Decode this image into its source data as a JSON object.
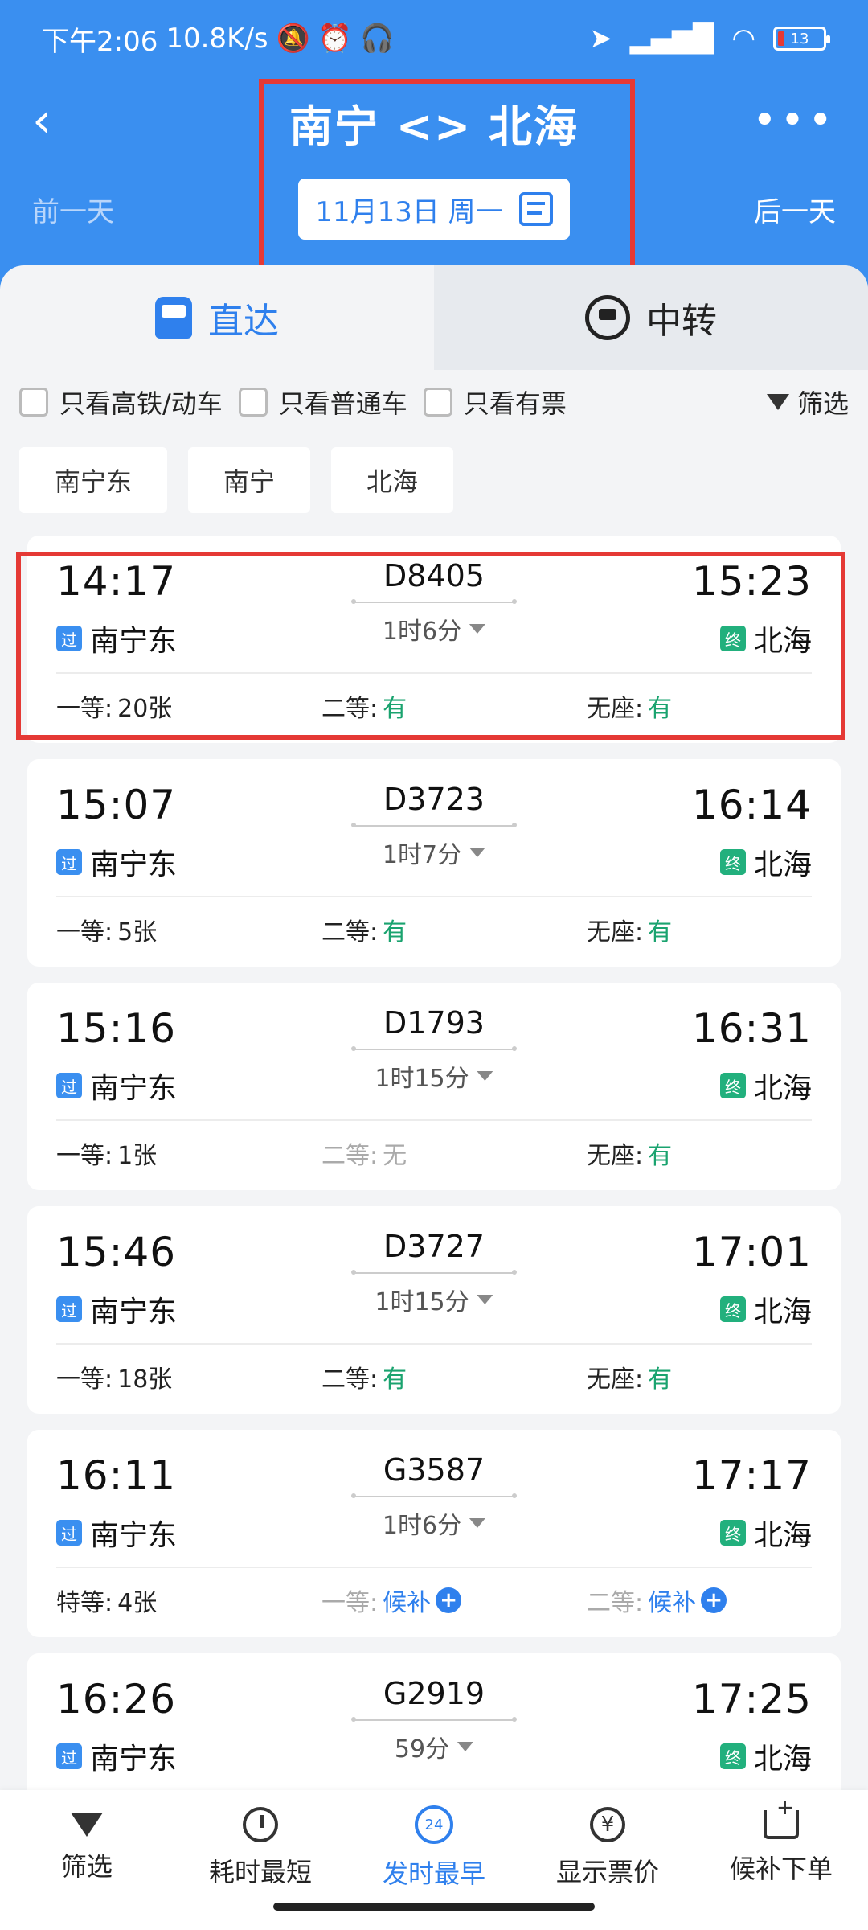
{
  "status_bar": {
    "time": "下午2:06",
    "net_speed": "10.8K/s",
    "battery": "13"
  },
  "header": {
    "title": "南宁 <> 北海",
    "prev_day": "前一天",
    "next_day": "后一天",
    "date": "11月13日 周一"
  },
  "mode_tabs": [
    {
      "label": "直达"
    },
    {
      "label": "中转"
    }
  ],
  "filters": {
    "only_high_speed": "只看高铁/动车",
    "only_normal": "只看普通车",
    "only_available": "只看有票",
    "filter_label": "筛选"
  },
  "stations": [
    "南宁东",
    "南宁",
    "北海"
  ],
  "trains": [
    {
      "dep_time": "14:17",
      "arr_time": "15:23",
      "train_no": "D8405",
      "duration": "1时6分",
      "dep_tag": "过",
      "dep_station": "南宁东",
      "arr_tag": "终",
      "arr_station": "北海",
      "seat1_label": "一等:",
      "seat1_value": "20张",
      "seat2_label": "二等:",
      "seat2_value": "有",
      "seat3_label": "无座:",
      "seat3_value": "有"
    },
    {
      "dep_time": "15:07",
      "arr_time": "16:14",
      "train_no": "D3723",
      "duration": "1时7分",
      "dep_tag": "过",
      "dep_station": "南宁东",
      "arr_tag": "终",
      "arr_station": "北海",
      "seat1_label": "一等:",
      "seat1_value": "5张",
      "seat2_label": "二等:",
      "seat2_value": "有",
      "seat3_label": "无座:",
      "seat3_value": "有"
    },
    {
      "dep_time": "15:16",
      "arr_time": "16:31",
      "train_no": "D1793",
      "duration": "1时15分",
      "dep_tag": "过",
      "dep_station": "南宁东",
      "arr_tag": "终",
      "arr_station": "北海",
      "seat1_label": "一等:",
      "seat1_value": "1张",
      "seat2_label": "二等:",
      "seat2_value": "无",
      "seat3_label": "无座:",
      "seat3_value": "有"
    },
    {
      "dep_time": "15:46",
      "arr_time": "17:01",
      "train_no": "D3727",
      "duration": "1时15分",
      "dep_tag": "过",
      "dep_station": "南宁东",
      "arr_tag": "终",
      "arr_station": "北海",
      "seat1_label": "一等:",
      "seat1_value": "18张",
      "seat2_label": "二等:",
      "seat2_value": "有",
      "seat3_label": "无座:",
      "seat3_value": "有"
    },
    {
      "dep_time": "16:11",
      "arr_time": "17:17",
      "train_no": "G3587",
      "duration": "1时6分",
      "dep_tag": "过",
      "dep_station": "南宁东",
      "arr_tag": "终",
      "arr_station": "北海",
      "seat1_label": "特等:",
      "seat1_value": "4张",
      "seat2_label": "一等:",
      "seat2_value": "候补",
      "seat3_label": "二等:",
      "seat3_value": "候补"
    },
    {
      "dep_time": "16:26",
      "arr_time": "17:25",
      "train_no": "G2919",
      "duration": "59分",
      "dep_tag": "过",
      "dep_station": "南宁东",
      "arr_tag": "终",
      "arr_station": "北海"
    }
  ],
  "bottom_nav": [
    {
      "label": "筛选",
      "icon": "funnel-icon"
    },
    {
      "label": "耗时最短",
      "icon": "clock-icon"
    },
    {
      "label": "发时最早",
      "icon": "24h-icon"
    },
    {
      "label": "显示票价",
      "icon": "yuan-icon"
    },
    {
      "label": "候补下单",
      "icon": "cart-icon"
    }
  ],
  "colors": {
    "header_bg": "#3a8ff0",
    "accent": "#2f80ed",
    "available_green": "#1aa36f",
    "annotation_red": "#e53935"
  }
}
